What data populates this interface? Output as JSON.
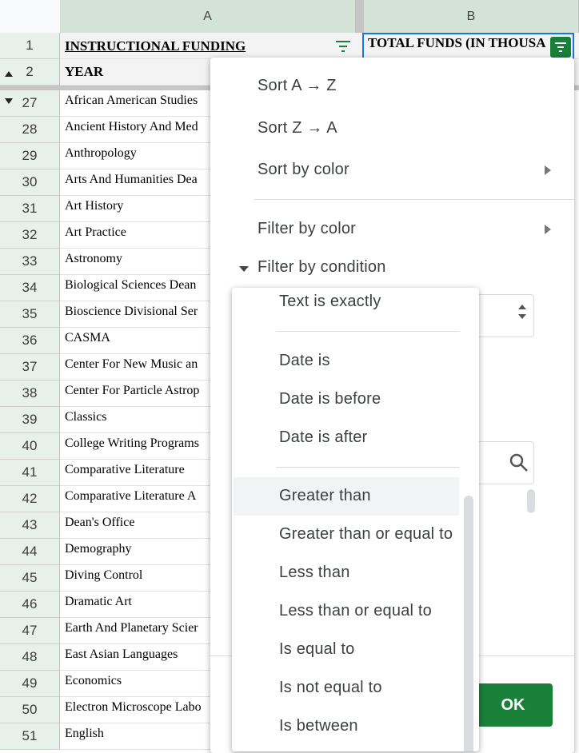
{
  "columns": {
    "a": "A",
    "b": "B"
  },
  "header_rows": [
    {
      "num": "1",
      "a": "INSTRUCTIONAL FUNDING",
      "b": "TOTAL FUNDS (IN THOUSA"
    },
    {
      "num": "2",
      "a": "YEAR"
    }
  ],
  "rows": [
    {
      "num": "27",
      "a": "African American Studies"
    },
    {
      "num": "28",
      "a": "Ancient History And Med"
    },
    {
      "num": "29",
      "a": "Anthropology"
    },
    {
      "num": "30",
      "a": "Arts And Humanities Dea"
    },
    {
      "num": "31",
      "a": "Art History"
    },
    {
      "num": "32",
      "a": "Art Practice"
    },
    {
      "num": "33",
      "a": "Astronomy"
    },
    {
      "num": "34",
      "a": "Biological Sciences Dean"
    },
    {
      "num": "35",
      "a": "Bioscience Divisional Ser"
    },
    {
      "num": "36",
      "a": "CASMA"
    },
    {
      "num": "37",
      "a": "Center For New Music an"
    },
    {
      "num": "38",
      "a": "Center For Particle Astrop"
    },
    {
      "num": "39",
      "a": "Classics"
    },
    {
      "num": "40",
      "a": "College Writing Programs"
    },
    {
      "num": "41",
      "a": "Comparative Literature"
    },
    {
      "num": "42",
      "a": "Comparative Literature A"
    },
    {
      "num": "43",
      "a": "Dean's Office"
    },
    {
      "num": "44",
      "a": "Demography"
    },
    {
      "num": "45",
      "a": "Diving Control"
    },
    {
      "num": "46",
      "a": "Dramatic Art"
    },
    {
      "num": "47",
      "a": "Earth And Planetary Scier"
    },
    {
      "num": "48",
      "a": "East Asian Languages"
    },
    {
      "num": "49",
      "a": "Economics"
    },
    {
      "num": "50",
      "a": "Electron Microscope Labo"
    },
    {
      "num": "51",
      "a": "English"
    }
  ],
  "menu": {
    "sort_az": "Sort A → Z",
    "sort_za": "Sort Z → A",
    "sort_color": "Sort by color",
    "filter_color": "Filter by color",
    "filter_condition": "Filter by condition",
    "ok": "OK"
  },
  "condition_options": {
    "text_exactly": "Text is exactly",
    "date_is": "Date is",
    "date_before": "Date is before",
    "date_after": "Date is after",
    "greater": "Greater than",
    "greater_eq": "Greater than or equal to",
    "less": "Less than",
    "less_eq": "Less than or equal to",
    "equal": "Is equal to",
    "not_equal": "Is not equal to",
    "between": "Is between"
  },
  "colors": {
    "accent": "#188038",
    "selected_header": "#d3e3d8",
    "highlight": "#f1f3f4"
  }
}
